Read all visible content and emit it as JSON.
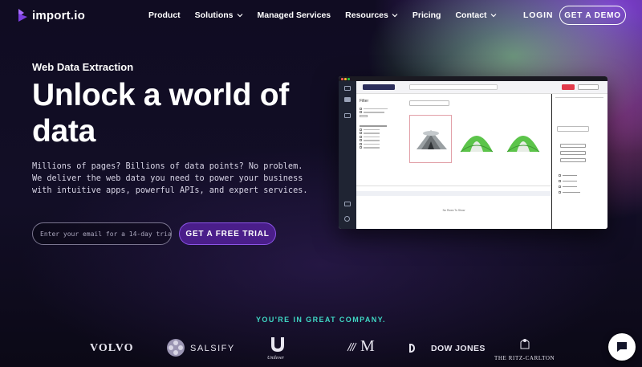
{
  "brand": {
    "name": "import.io",
    "logo_icon": "chevron-logo-icon",
    "accent": "#8b54e6"
  },
  "nav": {
    "items": [
      {
        "label": "Product",
        "dropdown": false
      },
      {
        "label": "Solutions",
        "dropdown": true
      },
      {
        "label": "Managed Services",
        "dropdown": false
      },
      {
        "label": "Resources",
        "dropdown": true
      },
      {
        "label": "Pricing",
        "dropdown": false
      },
      {
        "label": "Contact",
        "dropdown": true
      }
    ],
    "login_label": "LOGIN",
    "demo_label": "GET A DEMO"
  },
  "hero": {
    "eyebrow": "Web Data Extraction",
    "headline": "Unlock a world of data",
    "description": "Millions of pages? Billions of data points? No problem. We deliver the web data you need to power your business with intuitive apps, powerful APIs, and expert services.",
    "email_placeholder": "Enter your email for a 14-day trial",
    "cta_label": "GET A FREE TRIAL"
  },
  "app_preview": {
    "filter_title": "Filter",
    "no_rows": "No Rows To Show"
  },
  "social_proof": {
    "heading": "YOU'RE IN GREAT COMPANY.",
    "logos": [
      {
        "label": "VOLVO"
      },
      {
        "label": "SALSIFY"
      },
      {
        "label": "Unilever"
      },
      {
        "label": "M"
      },
      {
        "label": "DOW JONES"
      },
      {
        "label": "THE RITZ-CARLTON"
      }
    ],
    "heading_color": "#3fd8c4"
  },
  "chat": {
    "icon": "chat-bubble-icon"
  }
}
